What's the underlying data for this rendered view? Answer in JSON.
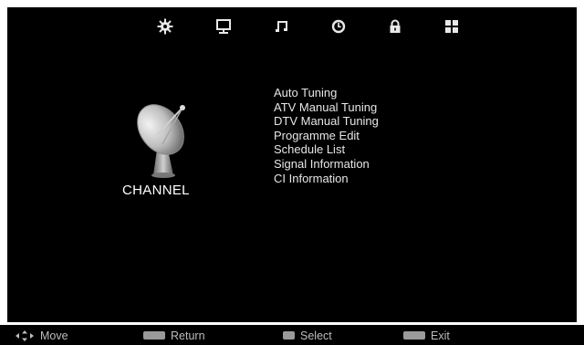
{
  "top_icons": [
    {
      "name": "settings-icon"
    },
    {
      "name": "picture-icon"
    },
    {
      "name": "sound-icon"
    },
    {
      "name": "clock-icon"
    },
    {
      "name": "lock-icon"
    },
    {
      "name": "apps-icon"
    }
  ],
  "channel": {
    "label": "CHANNEL",
    "icon": "satellite-dish-icon"
  },
  "menu": {
    "items": [
      "Auto Tuning",
      "ATV Manual Tuning",
      "DTV Manual Tuning",
      "Programme Edit",
      "Schedule List",
      "Signal Information",
      "CI Information"
    ]
  },
  "footer": {
    "move_label": "Move",
    "return_label": "Return",
    "select_label": "Select",
    "exit_label": "Exit"
  },
  "colors": {
    "background": "#000000",
    "text": "#e6e6e6",
    "footer_text": "#bdbdbd"
  }
}
